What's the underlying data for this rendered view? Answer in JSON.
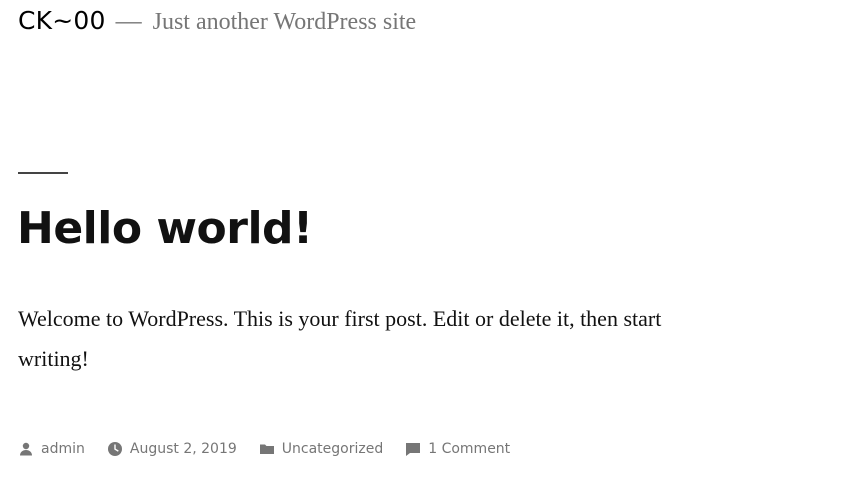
{
  "site": {
    "title": "CK~00",
    "separator": "—",
    "tagline": "Just another WordPress site"
  },
  "post": {
    "title": "Hello world!",
    "content": "Welcome to WordPress. This is your first post. Edit or delete it, then start writing!",
    "meta": {
      "author": "admin",
      "author_icon": "person-icon",
      "date": "August 2, 2019",
      "date_icon": "clock-icon",
      "category": "Uncategorized",
      "category_icon": "folder-icon",
      "comments": "1 Comment",
      "comments_icon": "comment-icon"
    }
  },
  "colors": {
    "text": "#111111",
    "muted": "#767676",
    "rule": "#444444",
    "background": "#ffffff"
  }
}
